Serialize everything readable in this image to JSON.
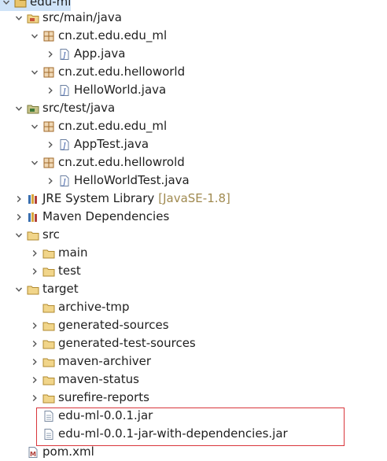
{
  "tree": {
    "root": {
      "label": "edu-ml"
    },
    "nodes": [
      {
        "key": "src_main_java",
        "label": "src/main/java"
      },
      {
        "key": "pkg_main",
        "label": "cn.zut.edu.edu_ml"
      },
      {
        "key": "app_java",
        "label": "App.java"
      },
      {
        "key": "pkg_hello",
        "label": "cn.zut.edu.helloworld"
      },
      {
        "key": "hello_java",
        "label": "HelloWorld.java"
      },
      {
        "key": "src_test_java",
        "label": "src/test/java"
      },
      {
        "key": "pkg_test",
        "label": "cn.zut.edu.edu_ml"
      },
      {
        "key": "apptest_java",
        "label": "AppTest.java"
      },
      {
        "key": "pkg_hellotest",
        "label": "cn.zut.edu.hellowrold"
      },
      {
        "key": "hellotest_java",
        "label": "HelloWorldTest.java"
      },
      {
        "key": "jre",
        "label": "JRE System Library",
        "decoration": "[JavaSE-1.8]"
      },
      {
        "key": "maven_deps",
        "label": "Maven Dependencies"
      },
      {
        "key": "src",
        "label": "src"
      },
      {
        "key": "main",
        "label": "main"
      },
      {
        "key": "test",
        "label": "test"
      },
      {
        "key": "target",
        "label": "target"
      },
      {
        "key": "archive_tmp",
        "label": "archive-tmp"
      },
      {
        "key": "gen_sources",
        "label": "generated-sources"
      },
      {
        "key": "gen_test_sources",
        "label": "generated-test-sources"
      },
      {
        "key": "maven_archiver",
        "label": "maven-archiver"
      },
      {
        "key": "maven_status",
        "label": "maven-status"
      },
      {
        "key": "surefire_reports",
        "label": "surefire-reports"
      },
      {
        "key": "jar1",
        "label": "edu-ml-0.0.1.jar"
      },
      {
        "key": "jar2",
        "label": "edu-ml-0.0.1-jar-with-dependencies.jar"
      },
      {
        "key": "pom",
        "label": "pom.xml"
      }
    ]
  },
  "icons": {
    "folder": "folder-icon",
    "source-folder": "source-folder-icon",
    "package": "package-icon",
    "java-file": "java-file-icon",
    "library": "library-icon",
    "jar-file": "jar-file-icon",
    "xml-file": "xml-file-icon",
    "project": "project-icon"
  },
  "colors": {
    "highlight_border": "#d9363b",
    "decoration_text": "#a08a50",
    "selection": "#cfe3f8"
  }
}
